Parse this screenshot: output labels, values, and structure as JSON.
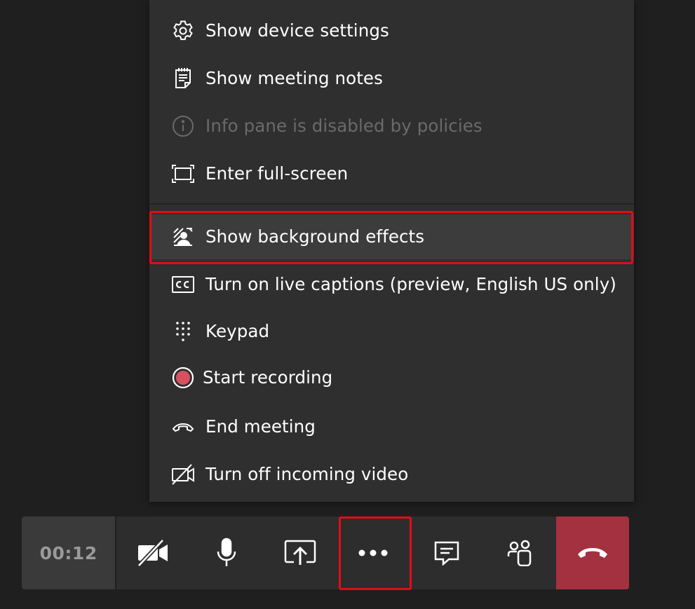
{
  "menu": {
    "items": [
      {
        "label": "Show device settings",
        "icon": "gear-icon",
        "enabled": true
      },
      {
        "label": "Show meeting notes",
        "icon": "notes-icon",
        "enabled": true
      },
      {
        "label": "Info pane is disabled by policies",
        "icon": "info-icon",
        "enabled": false
      },
      {
        "label": "Enter full-screen",
        "icon": "fullscreen-icon",
        "enabled": true
      },
      {
        "label": "Show background effects",
        "icon": "background-effects-icon",
        "enabled": true,
        "highlighted": true
      },
      {
        "label": "Turn on live captions (preview, English US only)",
        "icon": "closed-captions-icon",
        "enabled": true
      },
      {
        "label": "Keypad",
        "icon": "keypad-icon",
        "enabled": true
      },
      {
        "label": "Start recording",
        "icon": "record-icon",
        "enabled": true
      },
      {
        "label": "End meeting",
        "icon": "end-call-icon",
        "enabled": true
      },
      {
        "label": "Turn off incoming video",
        "icon": "video-off-icon",
        "enabled": true
      }
    ]
  },
  "toolbar": {
    "timer": "00:12",
    "buttons": [
      "camera-off-icon",
      "microphone-icon",
      "share-screen-icon",
      "more-options-icon",
      "chat-icon",
      "participants-icon",
      "hang-up-icon"
    ]
  },
  "colors": {
    "highlight": "#e60b16",
    "hangup": "#a4313f",
    "record": "#d9515f"
  }
}
